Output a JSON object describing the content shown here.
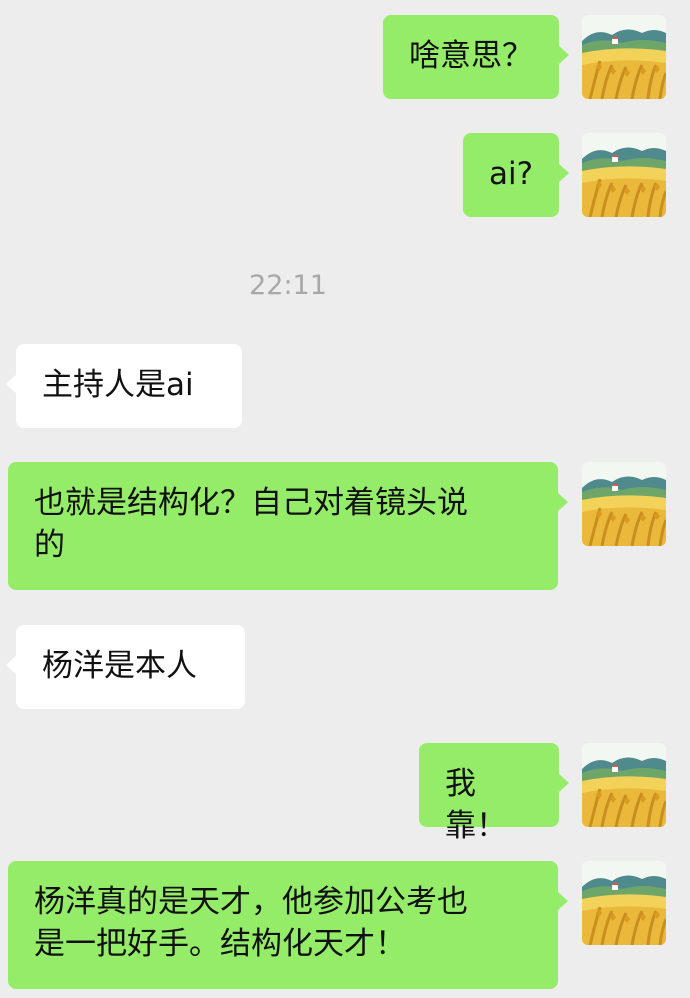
{
  "colors": {
    "background": "#ededed",
    "outgoing_bubble": "#95ec69",
    "incoming_bubble": "#ffffff",
    "text": "#111111",
    "timestamp": "#a8a8a8"
  },
  "avatar_icon": "landscape-wheat-field-avatar",
  "messages": [
    {
      "direction": "out",
      "text": "啥意思？"
    },
    {
      "direction": "out",
      "text": "ai?"
    },
    {
      "direction": "time",
      "text": "22:11"
    },
    {
      "direction": "in",
      "text": "主持人是ai"
    },
    {
      "direction": "out",
      "text": "也就是结构化？自己对着镜头说\n的"
    },
    {
      "direction": "in",
      "text": "杨洋是本人"
    },
    {
      "direction": "out",
      "text": "我靠！"
    },
    {
      "direction": "out",
      "text": "杨洋真的是天才，他参加公考也\n是一把好手。结构化天才！"
    }
  ]
}
